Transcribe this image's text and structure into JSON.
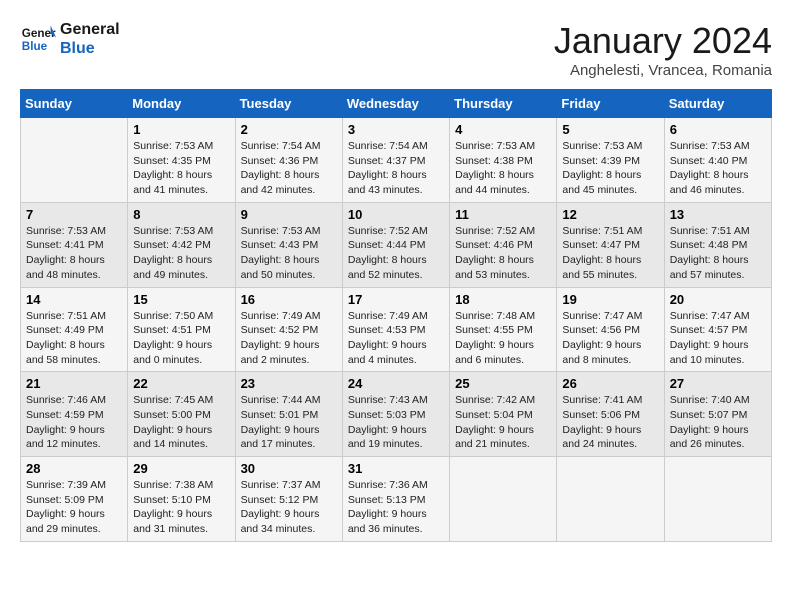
{
  "header": {
    "logo_line1": "General",
    "logo_line2": "Blue",
    "month": "January 2024",
    "location": "Anghelesti, Vrancea, Romania"
  },
  "days_of_week": [
    "Sunday",
    "Monday",
    "Tuesday",
    "Wednesday",
    "Thursday",
    "Friday",
    "Saturday"
  ],
  "weeks": [
    [
      {
        "day": "",
        "sunrise": "",
        "sunset": "",
        "daylight": ""
      },
      {
        "day": "1",
        "sunrise": "7:53 AM",
        "sunset": "4:35 PM",
        "daylight": "8 hours and 41 minutes."
      },
      {
        "day": "2",
        "sunrise": "7:54 AM",
        "sunset": "4:36 PM",
        "daylight": "8 hours and 42 minutes."
      },
      {
        "day": "3",
        "sunrise": "7:54 AM",
        "sunset": "4:37 PM",
        "daylight": "8 hours and 43 minutes."
      },
      {
        "day": "4",
        "sunrise": "7:53 AM",
        "sunset": "4:38 PM",
        "daylight": "8 hours and 44 minutes."
      },
      {
        "day": "5",
        "sunrise": "7:53 AM",
        "sunset": "4:39 PM",
        "daylight": "8 hours and 45 minutes."
      },
      {
        "day": "6",
        "sunrise": "7:53 AM",
        "sunset": "4:40 PM",
        "daylight": "8 hours and 46 minutes."
      }
    ],
    [
      {
        "day": "7",
        "sunrise": "7:53 AM",
        "sunset": "4:41 PM",
        "daylight": "8 hours and 48 minutes."
      },
      {
        "day": "8",
        "sunrise": "7:53 AM",
        "sunset": "4:42 PM",
        "daylight": "8 hours and 49 minutes."
      },
      {
        "day": "9",
        "sunrise": "7:53 AM",
        "sunset": "4:43 PM",
        "daylight": "8 hours and 50 minutes."
      },
      {
        "day": "10",
        "sunrise": "7:52 AM",
        "sunset": "4:44 PM",
        "daylight": "8 hours and 52 minutes."
      },
      {
        "day": "11",
        "sunrise": "7:52 AM",
        "sunset": "4:46 PM",
        "daylight": "8 hours and 53 minutes."
      },
      {
        "day": "12",
        "sunrise": "7:51 AM",
        "sunset": "4:47 PM",
        "daylight": "8 hours and 55 minutes."
      },
      {
        "day": "13",
        "sunrise": "7:51 AM",
        "sunset": "4:48 PM",
        "daylight": "8 hours and 57 minutes."
      }
    ],
    [
      {
        "day": "14",
        "sunrise": "7:51 AM",
        "sunset": "4:49 PM",
        "daylight": "8 hours and 58 minutes."
      },
      {
        "day": "15",
        "sunrise": "7:50 AM",
        "sunset": "4:51 PM",
        "daylight": "9 hours and 0 minutes."
      },
      {
        "day": "16",
        "sunrise": "7:49 AM",
        "sunset": "4:52 PM",
        "daylight": "9 hours and 2 minutes."
      },
      {
        "day": "17",
        "sunrise": "7:49 AM",
        "sunset": "4:53 PM",
        "daylight": "9 hours and 4 minutes."
      },
      {
        "day": "18",
        "sunrise": "7:48 AM",
        "sunset": "4:55 PM",
        "daylight": "9 hours and 6 minutes."
      },
      {
        "day": "19",
        "sunrise": "7:47 AM",
        "sunset": "4:56 PM",
        "daylight": "9 hours and 8 minutes."
      },
      {
        "day": "20",
        "sunrise": "7:47 AM",
        "sunset": "4:57 PM",
        "daylight": "9 hours and 10 minutes."
      }
    ],
    [
      {
        "day": "21",
        "sunrise": "7:46 AM",
        "sunset": "4:59 PM",
        "daylight": "9 hours and 12 minutes."
      },
      {
        "day": "22",
        "sunrise": "7:45 AM",
        "sunset": "5:00 PM",
        "daylight": "9 hours and 14 minutes."
      },
      {
        "day": "23",
        "sunrise": "7:44 AM",
        "sunset": "5:01 PM",
        "daylight": "9 hours and 17 minutes."
      },
      {
        "day": "24",
        "sunrise": "7:43 AM",
        "sunset": "5:03 PM",
        "daylight": "9 hours and 19 minutes."
      },
      {
        "day": "25",
        "sunrise": "7:42 AM",
        "sunset": "5:04 PM",
        "daylight": "9 hours and 21 minutes."
      },
      {
        "day": "26",
        "sunrise": "7:41 AM",
        "sunset": "5:06 PM",
        "daylight": "9 hours and 24 minutes."
      },
      {
        "day": "27",
        "sunrise": "7:40 AM",
        "sunset": "5:07 PM",
        "daylight": "9 hours and 26 minutes."
      }
    ],
    [
      {
        "day": "28",
        "sunrise": "7:39 AM",
        "sunset": "5:09 PM",
        "daylight": "9 hours and 29 minutes."
      },
      {
        "day": "29",
        "sunrise": "7:38 AM",
        "sunset": "5:10 PM",
        "daylight": "9 hours and 31 minutes."
      },
      {
        "day": "30",
        "sunrise": "7:37 AM",
        "sunset": "5:12 PM",
        "daylight": "9 hours and 34 minutes."
      },
      {
        "day": "31",
        "sunrise": "7:36 AM",
        "sunset": "5:13 PM",
        "daylight": "9 hours and 36 minutes."
      },
      {
        "day": "",
        "sunrise": "",
        "sunset": "",
        "daylight": ""
      },
      {
        "day": "",
        "sunrise": "",
        "sunset": "",
        "daylight": ""
      },
      {
        "day": "",
        "sunrise": "",
        "sunset": "",
        "daylight": ""
      }
    ]
  ]
}
